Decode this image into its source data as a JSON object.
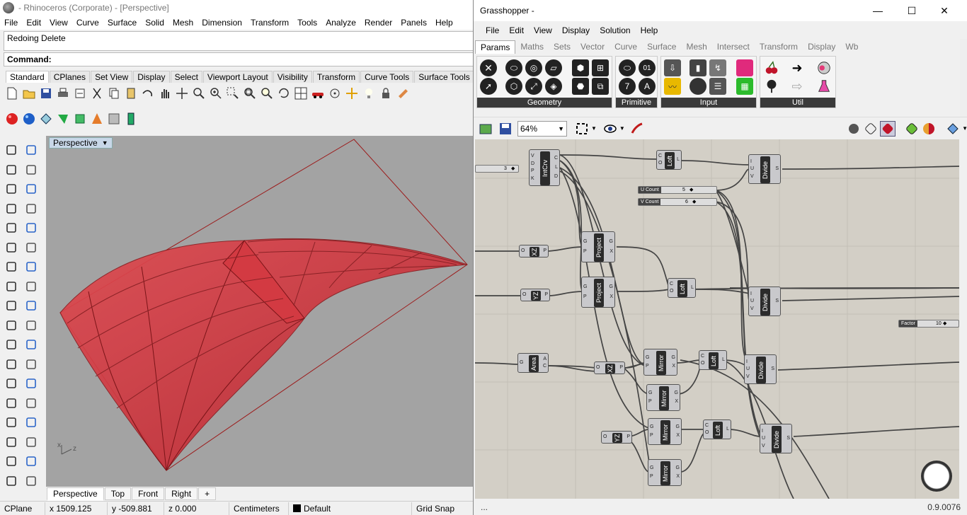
{
  "rhino": {
    "title": "- Rhinoceros (Corporate) - [Perspective]",
    "menu": [
      "File",
      "Edit",
      "View",
      "Curve",
      "Surface",
      "Solid",
      "Mesh",
      "Dimension",
      "Transform",
      "Tools",
      "Analyze",
      "Render",
      "Panels",
      "Help"
    ],
    "command_history": "Redoing Delete",
    "command_prompt": "Command:",
    "toolbar_tabs": [
      "Standard",
      "CPlanes",
      "Set View",
      "Display",
      "Select",
      "Viewport Layout",
      "Visibility",
      "Transform",
      "Curve Tools",
      "Surface Tools"
    ],
    "viewport_label": "Perspective",
    "viewport_tabs": [
      "Perspective",
      "Top",
      "Front",
      "Right"
    ],
    "viewport_add": "+",
    "axis_x": "x",
    "axis_z": "z",
    "status": {
      "cplane": "CPlane",
      "x": "x 1509.125",
      "y": "y -509.881",
      "z": "z 0.000",
      "units": "Centimeters",
      "layer": "Default",
      "snap": "Grid Snap"
    }
  },
  "gh": {
    "title": "Grasshopper -",
    "win_min": "—",
    "win_max": "☐",
    "win_close": "✕",
    "menu": [
      "File",
      "Edit",
      "View",
      "Display",
      "Solution",
      "Help"
    ],
    "tabs": [
      "Params",
      "Maths",
      "Sets",
      "Vector",
      "Curve",
      "Surface",
      "Mesh",
      "Intersect",
      "Transform",
      "Display",
      "Wb"
    ],
    "ribbon_groups": [
      "Geometry",
      "Primitive",
      "Input",
      "Util"
    ],
    "zoom": "64%",
    "status_left": "...",
    "status_right": "0.9.0076",
    "components": {
      "intcrv": "IntCrv",
      "loft": "Loft",
      "divide": "Divide",
      "project": "Project",
      "xz": "XZ",
      "yz": "YZ",
      "area": "Area",
      "mirror": "Mirror"
    },
    "sliders": {
      "n3": "3",
      "ucount_label": "U Count",
      "ucount_val": "5",
      "vcount_label": "V Count",
      "vcount_val": "6",
      "factor_label": "Factor",
      "factor_val": "10"
    },
    "pins": {
      "G": "G",
      "P": "P",
      "X": "X",
      "C": "C",
      "O": "O",
      "L": "L",
      "S": "S",
      "I": "I",
      "U": "U",
      "V": "V",
      "A": "A",
      "D": "D",
      "K": "K"
    }
  },
  "colors": {
    "surface_red": "#c8323a",
    "canvas": "#d3cfc6",
    "viewport_bg": "#a3a3a3"
  }
}
